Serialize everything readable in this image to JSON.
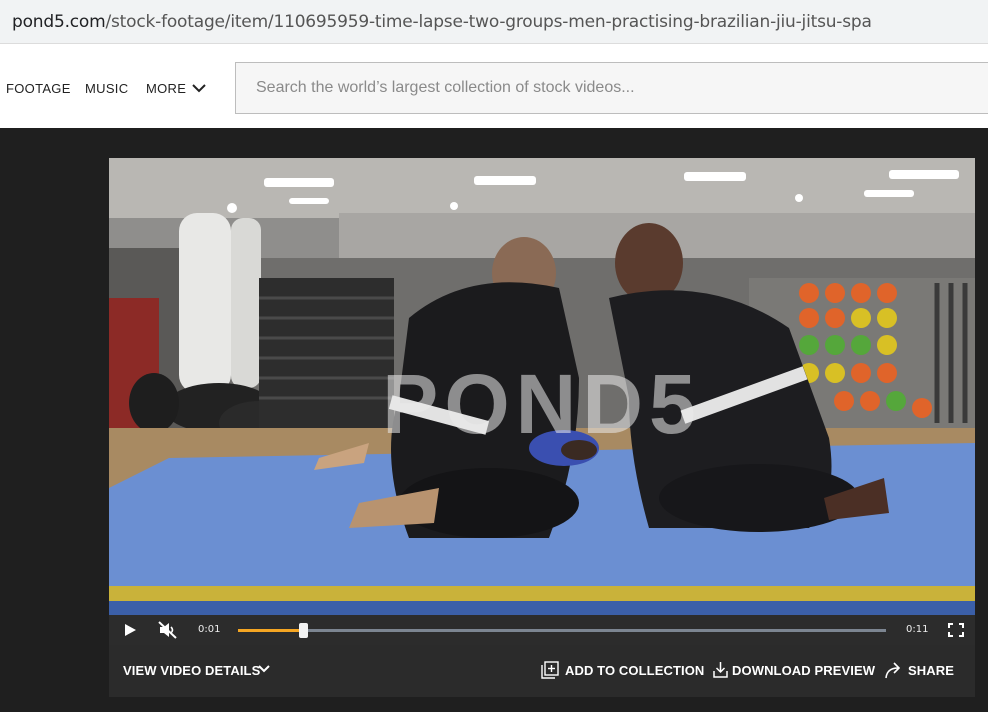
{
  "browser": {
    "url_domain": "pond5.com",
    "url_path": "/stock-footage/item/110695959-time-lapse-two-groups-men-practising-brazilian-jiu-jitsu-spa"
  },
  "nav": {
    "footage": "FOOTAGE",
    "music": "MUSIC",
    "more": "MORE",
    "more_icon": "chevron-down-icon"
  },
  "search": {
    "placeholder": "Search the world’s largest collection of stock videos...",
    "value": ""
  },
  "player": {
    "watermark": "POND5",
    "current_time": "0:01",
    "duration": "0:11",
    "progress": 0.1,
    "muted": true,
    "icons": [
      "play-icon",
      "mute-icon",
      "fullscreen-icon"
    ],
    "accent_color": "#f5a623"
  },
  "actions": {
    "view_details": "VIEW VIDEO DETAILS",
    "add_to_collection": "ADD TO COLLECTION",
    "download_preview": "DOWNLOAD PREVIEW",
    "share": "SHARE"
  }
}
